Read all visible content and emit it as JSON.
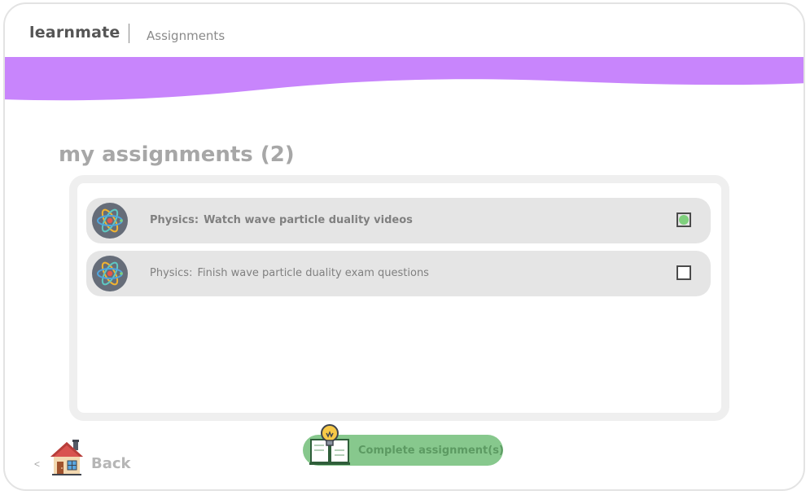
{
  "header": {
    "brand": "learnmate",
    "breadcrumb": "Assignments"
  },
  "main": {
    "title": "my assignments (2)",
    "assignments": [
      {
        "subject": "Physics:",
        "title": "Watch wave particle duality videos",
        "icon": "atom-icon",
        "checked": true
      },
      {
        "subject": "Physics:",
        "title": "Finish wave particle duality exam questions",
        "icon": "atom-icon",
        "checked": false
      }
    ]
  },
  "footer": {
    "back_chevron": "<",
    "back_label": "Back",
    "back_icon": "house-icon",
    "complete_label": "Complete assignment(s)",
    "complete_icon": "book-lightbulb-icon"
  },
  "colors": {
    "banner": "#c885fc",
    "complete_button": "#87c88d",
    "checked_dot": "#7fd07d",
    "row_background": "#e5e5e5"
  }
}
